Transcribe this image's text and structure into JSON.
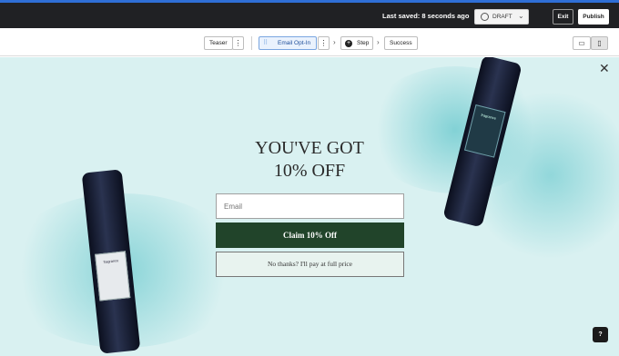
{
  "topbar": {
    "saved_text": "Last saved: 8 seconds ago",
    "status": "DRAFT",
    "exit_label": "Exit",
    "publish_label": "Publish"
  },
  "steps": {
    "teaser": "Teaser",
    "email_optin": "Email Opt-In",
    "step": "Step",
    "success": "Success"
  },
  "popup": {
    "headline_line1": "YOU'VE GOT",
    "headline_line2": "10% OFF",
    "email_placeholder": "Email",
    "claim_label": "Claim 10% Off",
    "decline_label": "No thanks? I'll pay at full price",
    "close_glyph": "✕"
  },
  "help_label": "?",
  "colors": {
    "canvas_bg": "#d9f1f1",
    "cta_green": "#21442a",
    "splash_teal": "#3bb8bf",
    "topbar_dark": "#202124"
  },
  "icons": [
    "status-circle-icon",
    "chevron-down-icon",
    "drag-handle-icon",
    "kebab-icon",
    "chevron-right-icon",
    "plus-circle-icon",
    "desktop-icon",
    "mobile-icon",
    "close-icon",
    "help-icon"
  ]
}
